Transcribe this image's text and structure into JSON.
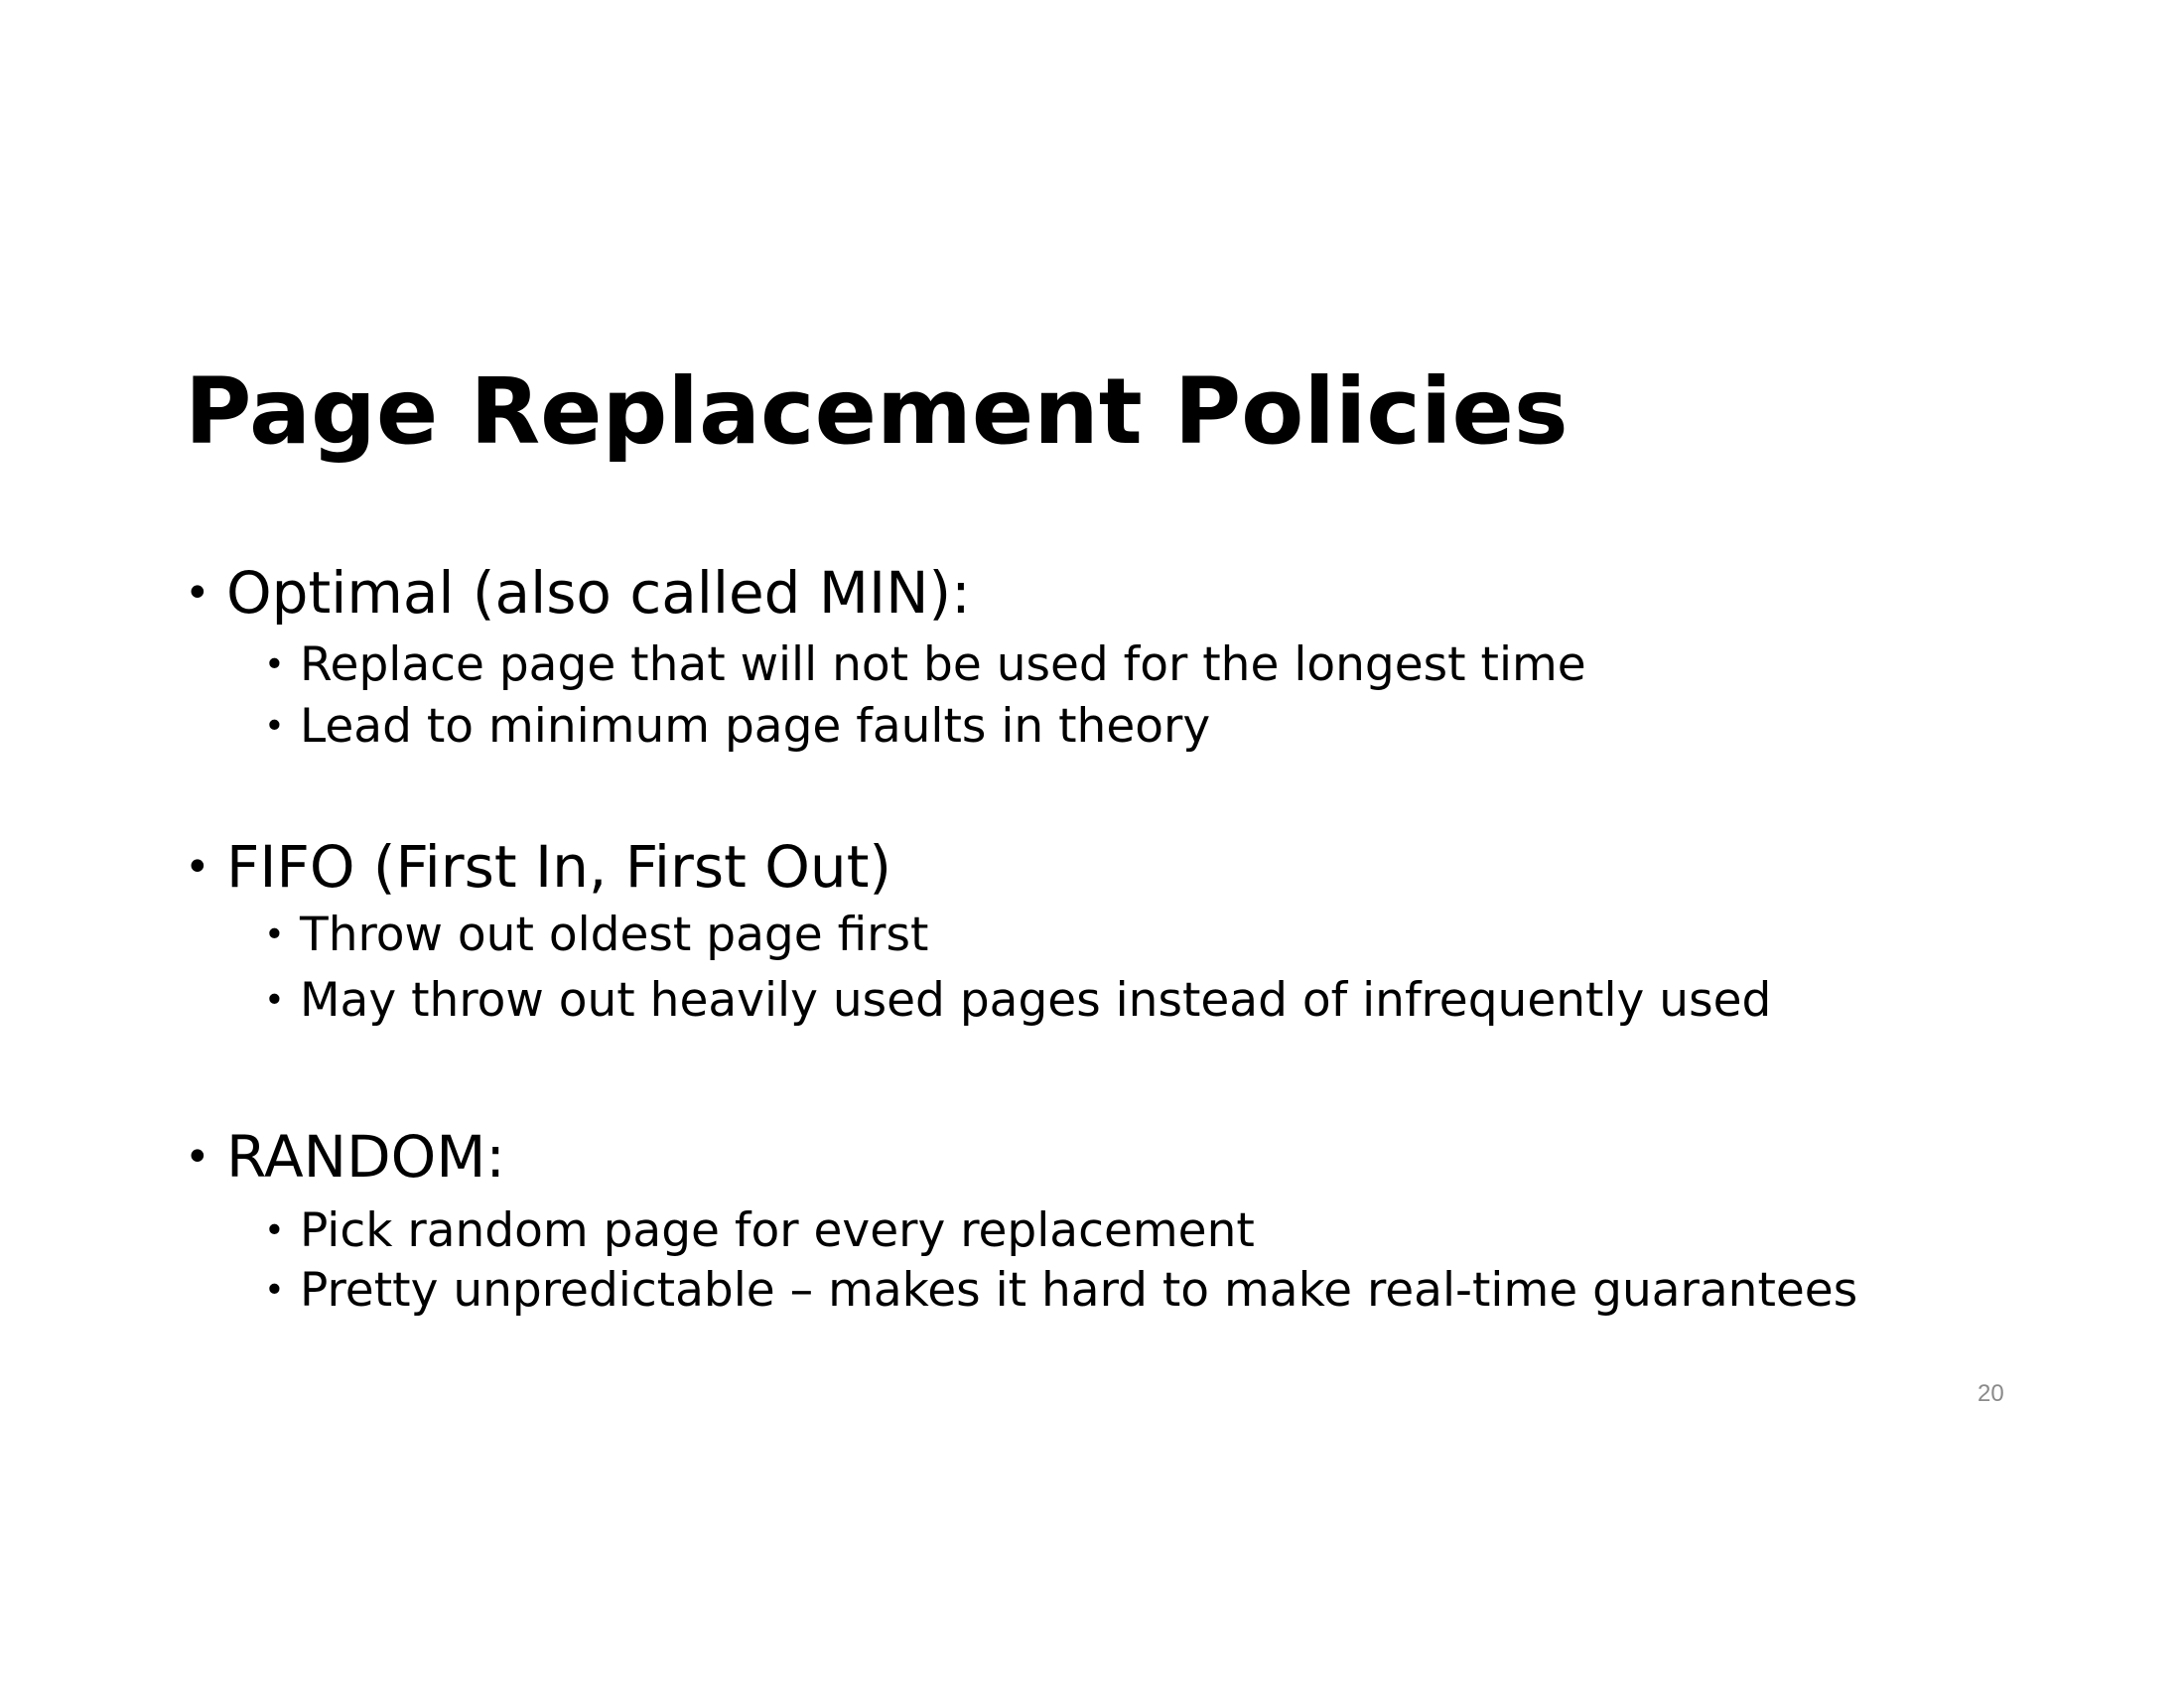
{
  "slide": {
    "title": "Page Replacement Policies",
    "page_number": "20",
    "bullets": [
      {
        "text": "Optimal (also called MIN):",
        "sub": [
          "Replace page that will not be used for the longest time",
          "Lead to minimum page faults in theory"
        ]
      },
      {
        "text": "FIFO (First In, First Out)",
        "sub": [
          "Throw out oldest page first",
          "May throw out heavily used pages instead of infrequently used"
        ]
      },
      {
        "text": "RANDOM:",
        "sub": [
          "Pick random page for every replacement",
          "Pretty unpredictable – makes it hard to make real-time guarantees"
        ]
      }
    ]
  }
}
